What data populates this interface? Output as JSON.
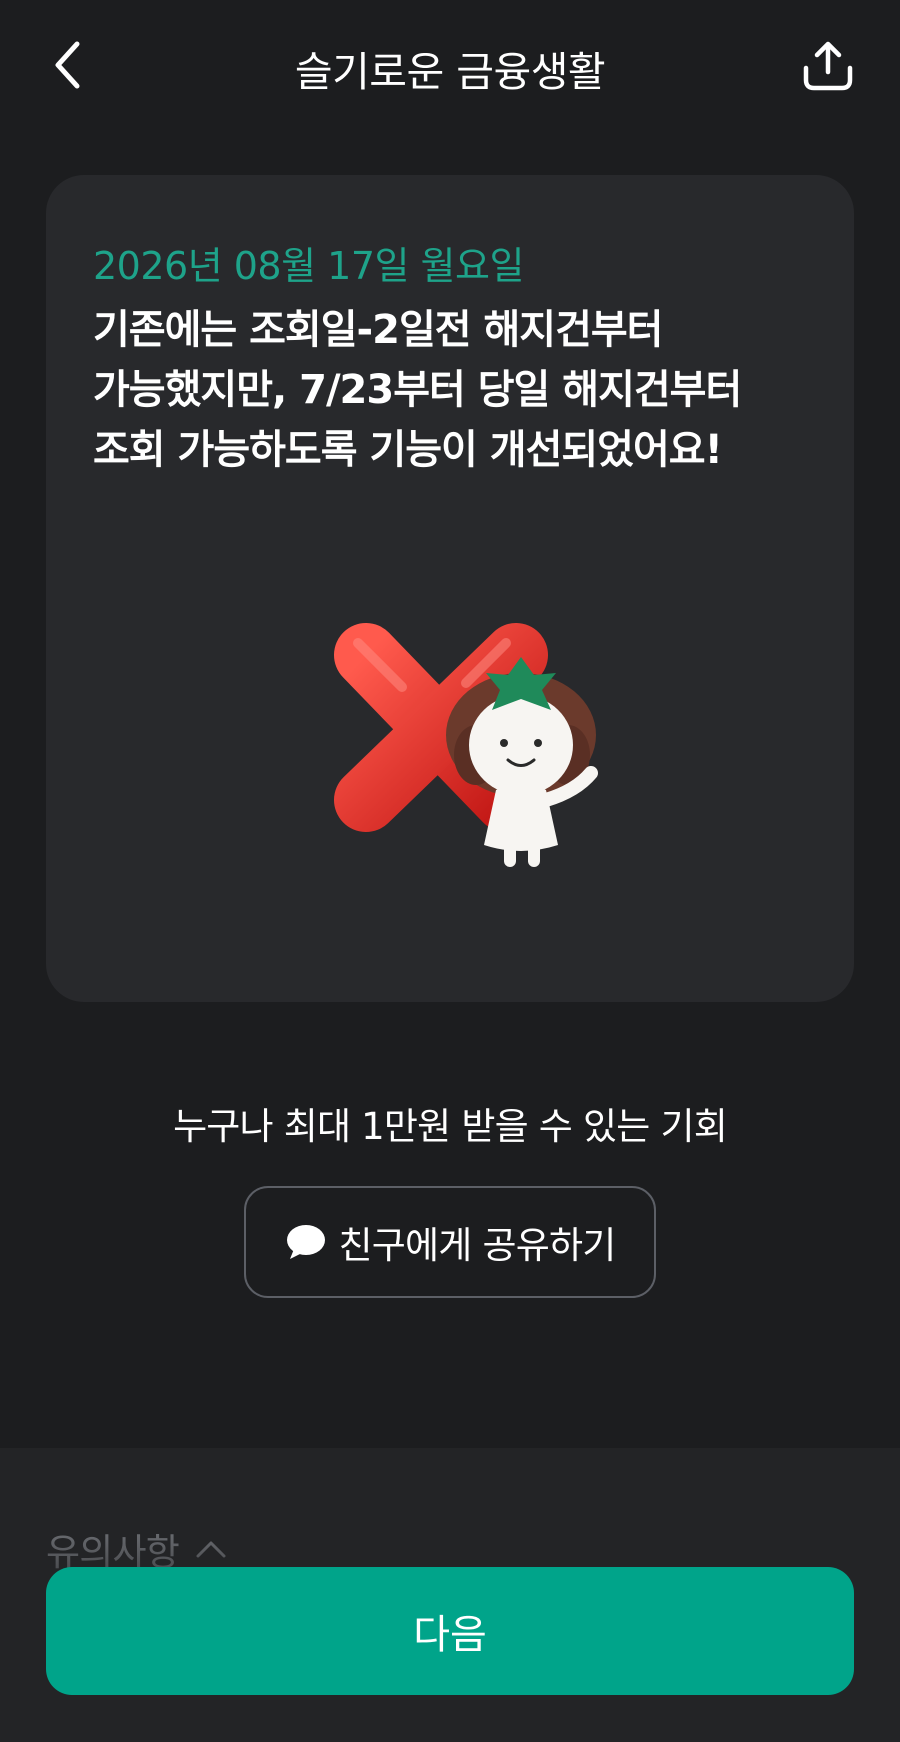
{
  "header": {
    "title": "슬기로운 금융생활",
    "back_icon": "chevron-left-icon",
    "share_icon": "share-upload-icon"
  },
  "card": {
    "date": "2026년 08월 17일 월요일",
    "message": "기존에는 조회일-2일전 해지건부터\n가능했지만, 7/23부터 당일 해지건부터\n조회 가능하도록 기능이 개선되었어요!",
    "illustration": "red-x-with-character"
  },
  "promo": {
    "chance_text": "누구나 최대 1만원 받을 수 있는 기회",
    "share_button_label": "친구에게 공유하기",
    "share_button_icon": "speech-bubble-icon"
  },
  "bottom": {
    "notice_label": "유의사항",
    "notice_icon": "chevron-up-icon",
    "next_button_label": "다음"
  },
  "colors": {
    "background": "#1c1d1f",
    "card": "#28292c",
    "accent": "#00a48a",
    "date_text": "#1ea38a"
  }
}
